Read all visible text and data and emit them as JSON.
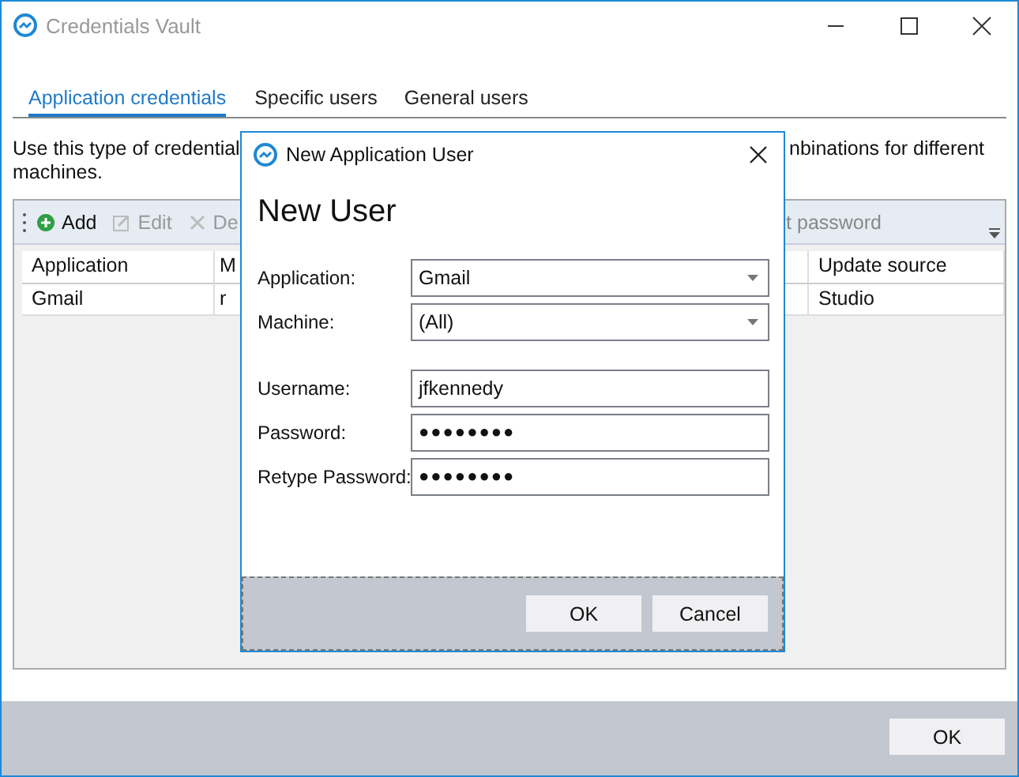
{
  "window": {
    "title": "Credentials Vault"
  },
  "tabs": [
    {
      "label": "Application credentials",
      "selected": true
    },
    {
      "label": "Specific users",
      "selected": false
    },
    {
      "label": "General users",
      "selected": false
    }
  ],
  "description": {
    "text_start": "Use this type of credential",
    "text_end": "nbinations for different",
    "text_line2": "machines."
  },
  "toolbar": {
    "items": [
      {
        "label": "Add",
        "kind": "add",
        "disabled": false
      },
      {
        "label": "Edit",
        "kind": "edit",
        "disabled": true
      },
      {
        "label": "De",
        "kind": "delete",
        "disabled": true
      }
    ],
    "right_label": "t password"
  },
  "table": {
    "columns": [
      "Application",
      "M",
      "Update source"
    ],
    "rows": [
      [
        "Gmail",
        "r",
        "Studio"
      ]
    ]
  },
  "dialog": {
    "title": "New Application User",
    "heading": "New User",
    "field_groups": [
      [
        {
          "label": "Application:",
          "value": "Gmail",
          "kind": "dropdown"
        },
        {
          "label": "Machine:",
          "value": "(All)",
          "kind": "dropdown"
        }
      ],
      [
        {
          "label": "Username:",
          "value": "jfkennedy",
          "kind": "text"
        },
        {
          "label": "Password:",
          "value": "●●●●●●●●",
          "kind": "password"
        },
        {
          "label": "Retype Password:",
          "value": "●●●●●●●●",
          "kind": "password"
        }
      ]
    ],
    "buttons": [
      "OK",
      "Cancel"
    ]
  },
  "footer_buttons": [
    "OK"
  ]
}
